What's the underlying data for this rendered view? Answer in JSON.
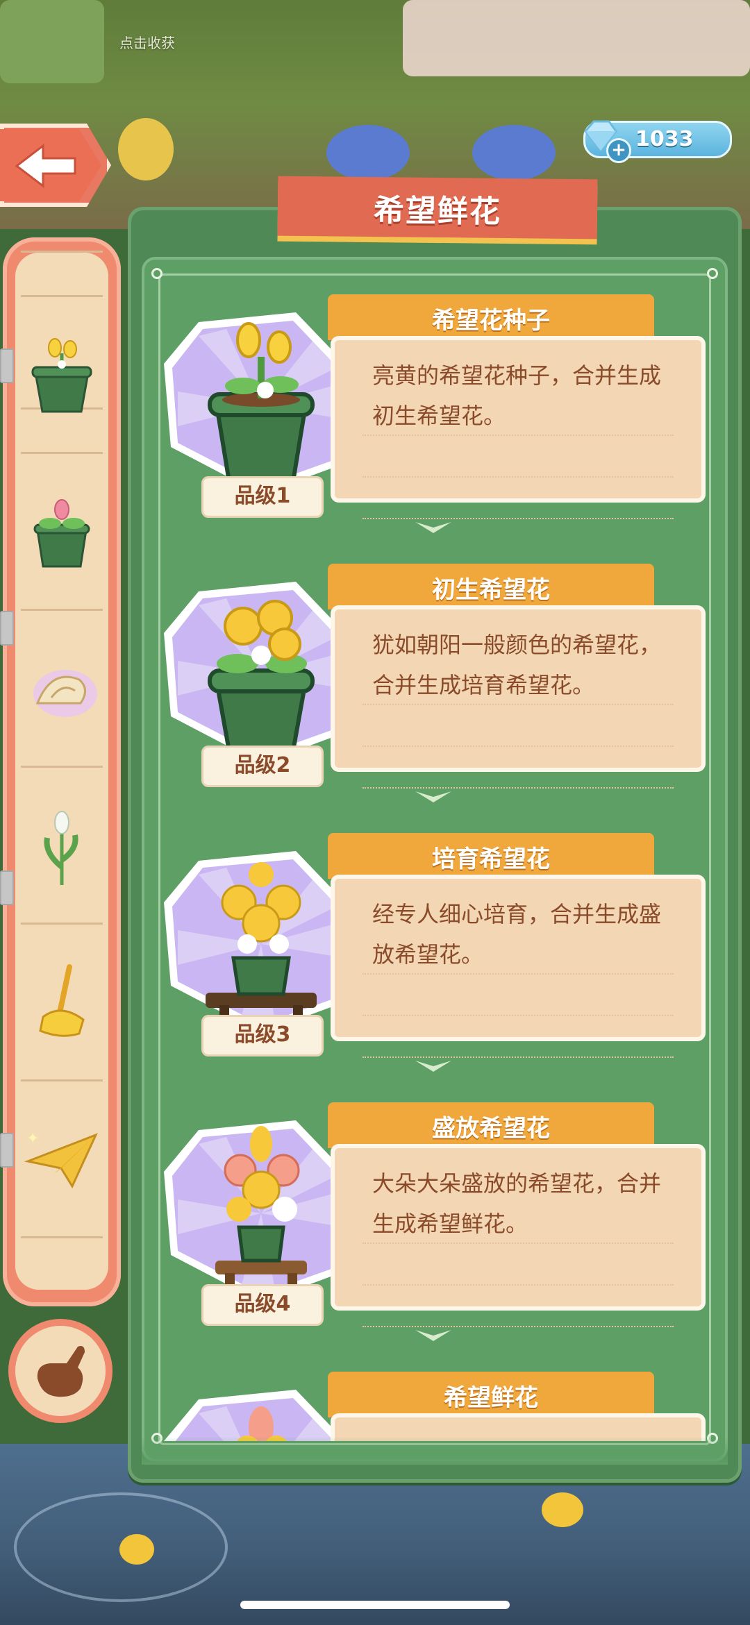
{
  "scene": {
    "harvest_hint": "点击收获"
  },
  "currency": {
    "gems": "1033",
    "icon": "diamond-icon",
    "add_icon": "plus-icon"
  },
  "back_button": {
    "icon": "arrow-left-icon"
  },
  "panel": {
    "title": "希望鲜花"
  },
  "sidebar": {
    "items": [
      {
        "icon": "yellow-flower-pot-icon"
      },
      {
        "icon": "pink-bud-pot-icon"
      },
      {
        "icon": "seashell-icon"
      },
      {
        "icon": "lily-sprout-icon"
      },
      {
        "icon": "golden-broom-icon"
      },
      {
        "icon": "paper-plane-icon"
      }
    ],
    "hand_button_icon": "pointing-hand-icon"
  },
  "items": [
    {
      "name": "希望花种子",
      "description": "亮黄的希望花种子，合并生成初生希望花。",
      "grade": "品级1",
      "icon": "seedling-pot-icon"
    },
    {
      "name": "初生希望花",
      "description": "犹如朝阳一般颜色的希望花，合并生成培育希望花。",
      "grade": "品级2",
      "icon": "young-flower-pot-icon"
    },
    {
      "name": "培育希望花",
      "description": "经专人细心培育，合并生成盛放希望花。",
      "grade": "品级3",
      "icon": "cultivated-flower-pot-icon"
    },
    {
      "name": "盛放希望花",
      "description": "大朵大朵盛放的希望花，合并生成希望鲜花。",
      "grade": "品级4",
      "icon": "blooming-flower-pot-icon"
    },
    {
      "name": "希望鲜花",
      "description": "",
      "grade": "",
      "icon": "fresh-flower-bouquet-icon"
    }
  ],
  "colors": {
    "panel_green": "#4f8a56",
    "banner_red": "#e06b52",
    "name_tab_orange": "#f0a83c",
    "desc_bg": "#f3d7b5",
    "text_brown": "#8a4b2a",
    "hex_purple": "#c9b6f2"
  }
}
